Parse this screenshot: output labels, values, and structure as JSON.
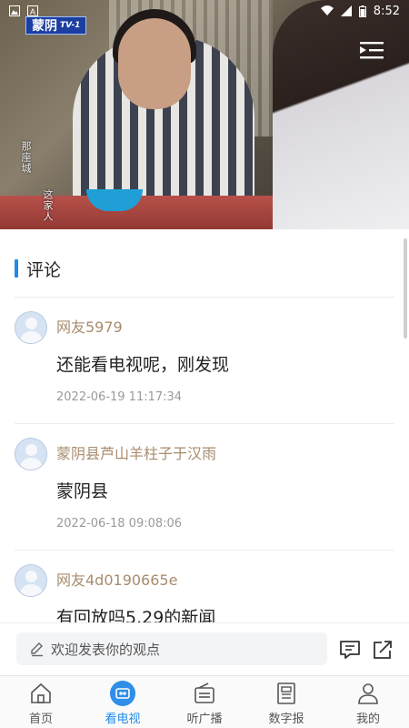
{
  "status_bar": {
    "time": "8:52"
  },
  "player": {
    "channel_name": "蒙阴",
    "channel_suffix": "TV-1",
    "caption_lines": [
      "那座城",
      "这家人"
    ]
  },
  "comments_section": {
    "title": "评论",
    "items": [
      {
        "username": "网友5979",
        "content": "还能看电视呢，刚发现",
        "time": "2022-06-19 11:17:34"
      },
      {
        "username": "蒙阴县芦山羊柱子于汉雨",
        "content": "蒙阴县",
        "time": "2022-06-18 09:08:06"
      },
      {
        "username": "网友4d0190665e",
        "content": "有回放吗5.29的新闻",
        "time": ""
      }
    ]
  },
  "comment_input": {
    "placeholder": "欢迎发表你的观点"
  },
  "tabbar": {
    "active": 1,
    "items": [
      {
        "label": "首页",
        "icon": "home-icon"
      },
      {
        "label": "看电视",
        "icon": "tv-icon"
      },
      {
        "label": "听广播",
        "icon": "radio-icon"
      },
      {
        "label": "数字报",
        "icon": "newspaper-icon"
      },
      {
        "label": "我的",
        "icon": "profile-icon"
      }
    ]
  },
  "colors": {
    "accent": "#1e8be8",
    "username": "#a88c6e",
    "channel_logo": "#1b3ea0"
  }
}
